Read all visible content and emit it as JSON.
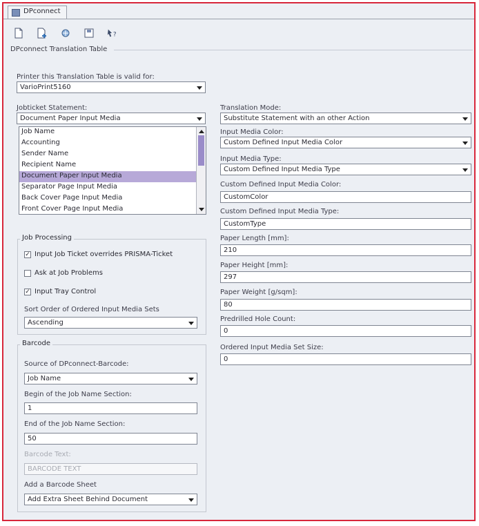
{
  "window": {
    "tab_label": "DPconnect"
  },
  "toolbar": {
    "icons": [
      "new-document-icon",
      "add-document-icon",
      "sync-icon",
      "save-icon",
      "help-cursor-icon"
    ]
  },
  "section_title": "DPconnect Translation Table",
  "printer": {
    "label": "Printer this Translation Table is valid for:",
    "value": "VarioPrint5160"
  },
  "jobticket": {
    "label": "Jobticket Statement:",
    "value": "Document Paper Input Media",
    "items": [
      "Job Name",
      "Accounting",
      "Sender Name",
      "Recipient Name",
      "Document Paper Input Media",
      "Separator Page Input Media",
      "Back Cover Page Input Media",
      "Front Cover Page Input Media"
    ],
    "selected_index": 4
  },
  "job_processing": {
    "title": "Job Processing",
    "input_ticket_label": "Input Job Ticket overrides PRISMA-Ticket",
    "input_ticket_checked": true,
    "ask_label": "Ask at Job Problems",
    "ask_checked": false,
    "tray_label": "Input Tray Control",
    "tray_checked": true,
    "sort_label": "Sort Order of Ordered Input Media Sets",
    "sort_value": "Ascending"
  },
  "barcode": {
    "title": "Barcode",
    "source_label": "Source of DPconnect-Barcode:",
    "source_value": "Job Name",
    "begin_label": "Begin of the Job Name Section:",
    "begin_value": "1",
    "end_label": "End of the Job Name Section:",
    "end_value": "50",
    "text_label": "Barcode Text:",
    "text_value": "BARCODE TEXT",
    "sheet_label": "Add a Barcode Sheet",
    "sheet_value": "Add Extra Sheet Behind Document"
  },
  "right": {
    "mode_label": "Translation Mode:",
    "mode_value": "Substitute Statement with an other Action",
    "color_label": "Input Media Color:",
    "color_value": "Custom Defined Input Media Color",
    "type_label": "Input Media Type:",
    "type_value": "Custom Defined Input Media Type",
    "custom_color_label": "Custom Defined Input Media Color:",
    "custom_color_value": "CustomColor",
    "custom_type_label": "Custom Defined Input Media Type:",
    "custom_type_value": "CustomType",
    "length_label": "Paper Length [mm]:",
    "length_value": "210",
    "height_label": "Paper Height [mm]:",
    "height_value": "297",
    "weight_label": "Paper Weight [g/sqm]:",
    "weight_value": "80",
    "hole_label": "Predrilled Hole Count:",
    "hole_value": "0",
    "set_size_label": "Ordered Input Media Set Size:",
    "set_size_value": "0"
  }
}
